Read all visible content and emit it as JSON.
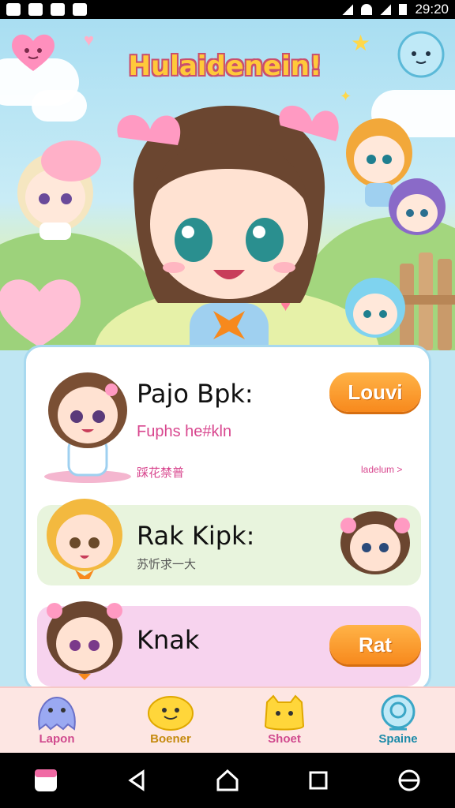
{
  "statusbar": {
    "time": "29:20"
  },
  "hero": {
    "title": "Hulaidenein!"
  },
  "cards": [
    {
      "title": "Pajo Bpk:",
      "subtitle": "Fuphs he#kln",
      "small": "踩花禁普",
      "link": "ladelum >",
      "button": "Louvi"
    },
    {
      "title": "Rak Kipk:",
      "small": "苏忻求一大"
    },
    {
      "title": "Knak",
      "button": "Rat"
    }
  ],
  "nav": [
    {
      "label": "Lapon",
      "color": "#d04a8e"
    },
    {
      "label": "Boener",
      "color": "#c58a0e"
    },
    {
      "label": "Shoet",
      "color": "#d04a8e"
    },
    {
      "label": "Spaine",
      "color": "#1b8aa8"
    }
  ],
  "colors": {
    "accent": "#f7891d",
    "pink": "#d8468e",
    "panel_border": "#a8d9ef"
  }
}
